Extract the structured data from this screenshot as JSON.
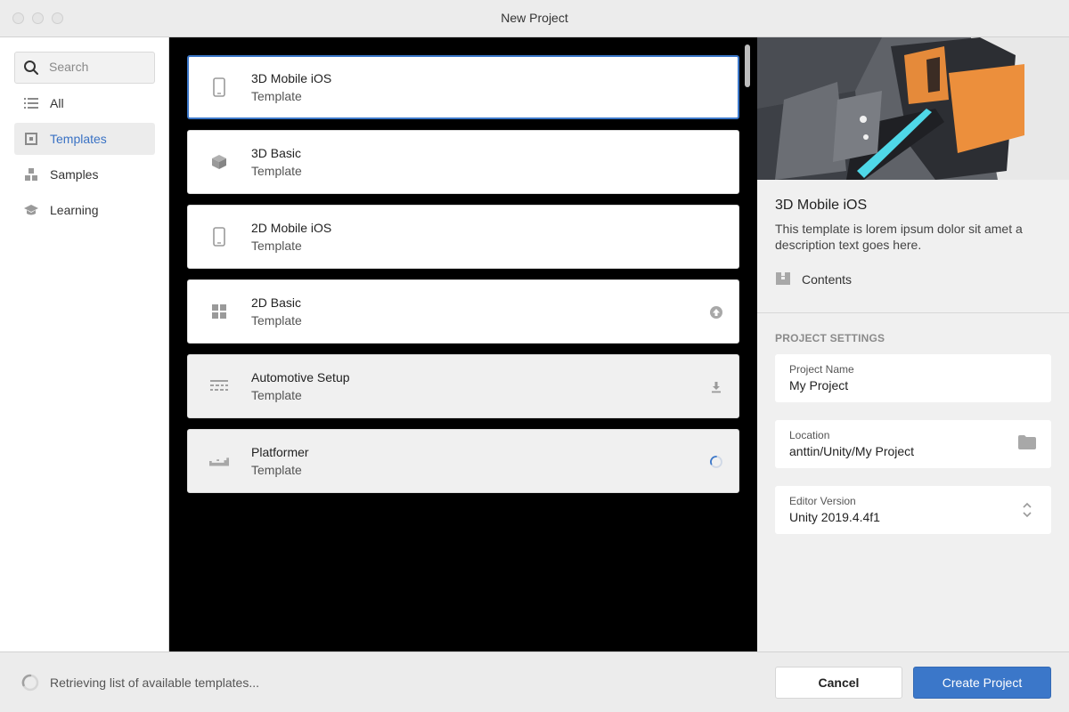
{
  "window": {
    "title": "New Project"
  },
  "sidebar": {
    "search_placeholder": "Search",
    "items": [
      {
        "label": "All",
        "icon": "list-icon",
        "active": false
      },
      {
        "label": "Templates",
        "icon": "template-icon",
        "active": true
      },
      {
        "label": "Samples",
        "icon": "samples-icon",
        "active": false
      },
      {
        "label": "Learning",
        "icon": "graduation-cap-icon",
        "active": false
      }
    ]
  },
  "templates": [
    {
      "title": "3D Mobile iOS",
      "subtitle": "Template",
      "icon": "mobile-phone-icon",
      "state": "selected",
      "action": ""
    },
    {
      "title": "3D Basic",
      "subtitle": "Template",
      "icon": "cube-icon",
      "state": "available",
      "action": ""
    },
    {
      "title": "2D Mobile iOS",
      "subtitle": "Template",
      "icon": "mobile-phone-icon",
      "state": "available",
      "action": ""
    },
    {
      "title": "2D Basic",
      "subtitle": "Template",
      "icon": "grid-icon",
      "state": "update",
      "action": "upload-arrow-icon"
    },
    {
      "title": "Automotive Setup",
      "subtitle": "Template",
      "icon": "automotive-icon",
      "state": "download",
      "action": "download-icon"
    },
    {
      "title": "Platformer",
      "subtitle": "Template",
      "icon": "platformer-icon",
      "state": "loading",
      "action": "loading-spinner-icon"
    }
  ],
  "detail": {
    "title": "3D Mobile iOS",
    "description": "This template is lorem ipsum dolor sit amet a description text goes here.",
    "contents_label": "Contents"
  },
  "settings": {
    "header": "PROJECT SETTINGS",
    "project_name": {
      "label": "Project Name",
      "value": "My Project"
    },
    "location": {
      "label": "Location",
      "value": "anttin/Unity/My Project"
    },
    "editor_version": {
      "label": "Editor Version",
      "value": "Unity 2019.4.4f1"
    }
  },
  "footer": {
    "status": "Retrieving list of available templates...",
    "cancel_label": "Cancel",
    "create_label": "Create Project"
  },
  "colors": {
    "accent": "#3b77c9",
    "list_background": "#000000",
    "preview_orange": "#e58a3a",
    "preview_cyan": "#4fd8e8"
  }
}
